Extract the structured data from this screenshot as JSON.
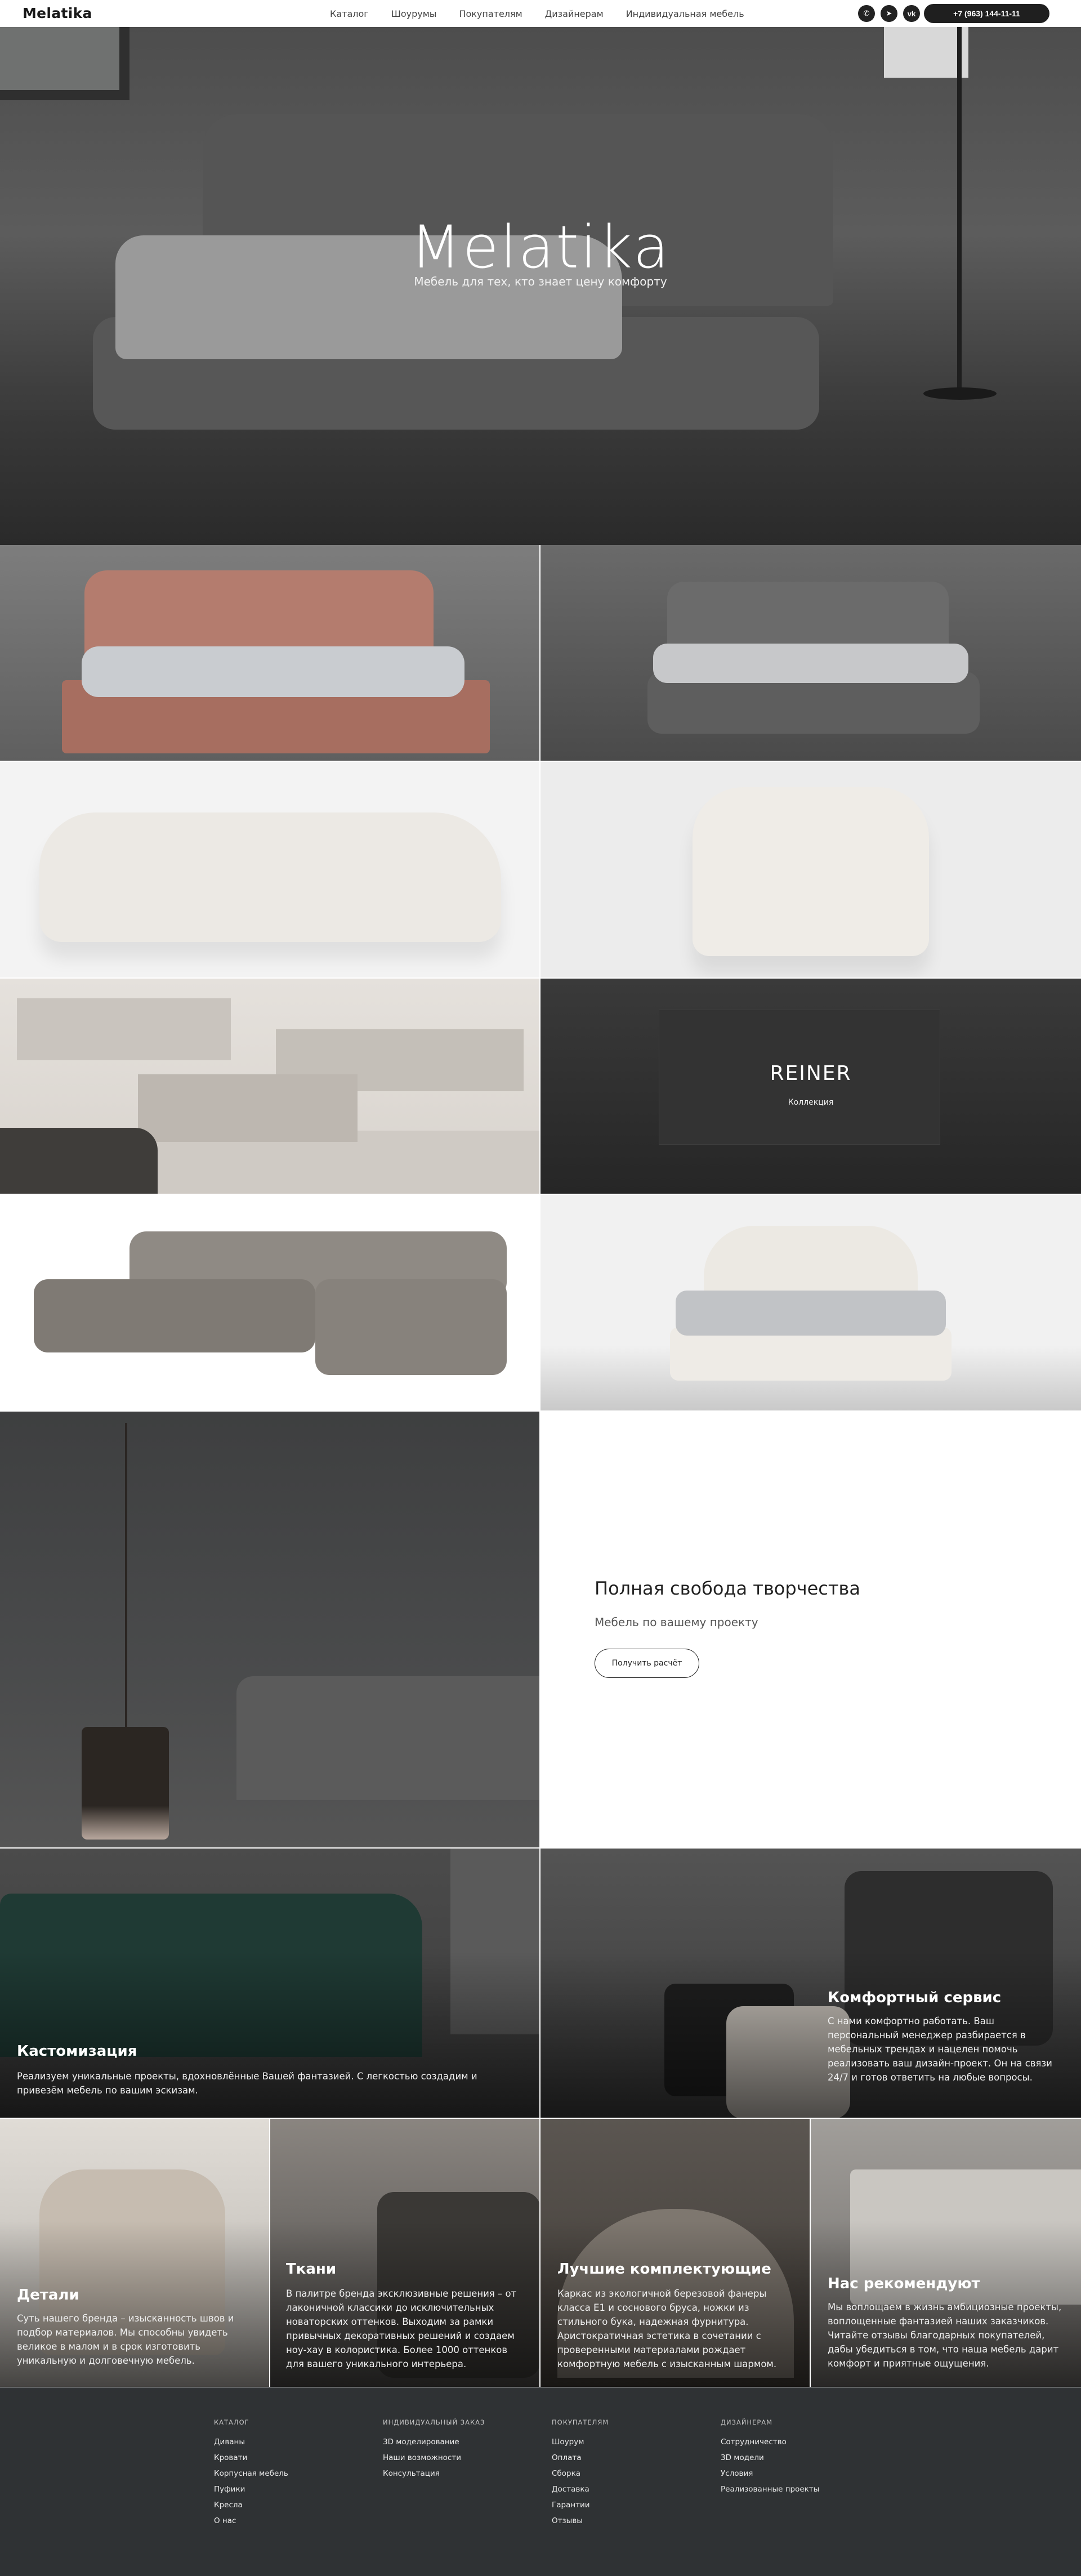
{
  "header": {
    "logo": "Melatika",
    "nav": [
      "Каталог",
      "Шоурумы",
      "Покупателям",
      "Дизайнерам",
      "Индивидуальная мебель"
    ],
    "socials": [
      {
        "icon": "whatsapp-icon",
        "glyph": "✆"
      },
      {
        "icon": "telegram-icon",
        "glyph": "➤"
      },
      {
        "icon": "vk-icon",
        "glyph": "vk"
      }
    ],
    "phone": "+7 (963) 144-11-11"
  },
  "hero": {
    "title": "Melatika",
    "subtitle": "Мебель для тех, кто знает цену комфорту"
  },
  "reiner": {
    "title": "REINER",
    "subtitle": "Коллекция"
  },
  "freedom": {
    "title": "Полная свобода творчества",
    "subtitle": "Мебель по вашему проекту",
    "button": "Получить расчёт"
  },
  "features": {
    "custom": {
      "title": "Кастомизация",
      "text": "Реализуем уникальные проекты, вдохновлённые Вашей фантазией. С легкостью создадим и привезём мебель по вашим эскизам."
    },
    "comfort": {
      "title": "Комфортный сервис",
      "text": "С нами комфортно работать. Ваш персональный менеджер разбирается в мебельных трендах и нацелен помочь реализовать ваш дизайн-проект. Он на связи 24/7 и готов ответить на любые вопросы."
    },
    "details": {
      "title": "Детали",
      "text": "Суть нашего бренда – изысканность швов и подбор материалов. Мы способны увидеть великое в малом и в срок изготовить уникальную и долговечную мебель."
    },
    "fabrics": {
      "title": "Ткани",
      "text": "В палитре бренда эксклюзивные решения – от лаконичной классики до исключительных новаторских оттенков. Выходим за рамки привычных декоративных решений и создаем ноу-хау в колористика. Более 1000 оттенков для вашего уникального интерьера."
    },
    "components": {
      "title": "Лучшие комплектующие",
      "text": "Каркас из экологичной березовой фанеры класса Е1 и соснового бруса, ножки из стильного бука, надежная фурнитура. Аристократичная эстетика в сочетании с проверенными материалами рождает комфортную мебель с изысканным шармом."
    },
    "recommend": {
      "title": "Нас рекомендуют",
      "text": "Мы воплощаем в жизнь амбициозные проекты, воплощенные фантазией наших заказчиков. Читайте отзывы благодарных покупателей, дабы убедиться в том, что наша мебель дарит комфорт и приятные ощущения."
    }
  },
  "footer": {
    "columns": [
      {
        "heading": "Каталог",
        "links": [
          "Диваны",
          "Кровати",
          "Корпусная мебель",
          "Пуфики",
          "Кресла",
          "О нас"
        ]
      },
      {
        "heading": "Индивидуальный заказ",
        "links": [
          "3D моделирование",
          "Наши возможности",
          "Консультация"
        ]
      },
      {
        "heading": "Покупателям",
        "links": [
          "Шоурум",
          "Оплата",
          "Сборка",
          "Доставка",
          "Гарантии",
          "Отзывы"
        ]
      },
      {
        "heading": "Дизайнерам",
        "links": [
          "Сотрудничество",
          "3D модели",
          "Условия",
          "Реализованные проекты"
        ]
      }
    ]
  },
  "colors": {
    "accent": "#1f1f1f",
    "footer_bg": "#2f3234"
  }
}
